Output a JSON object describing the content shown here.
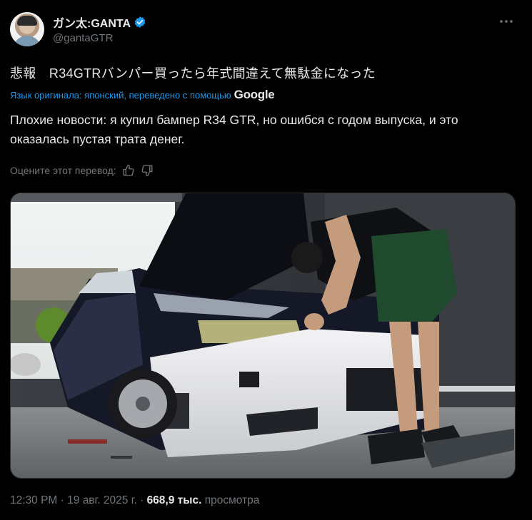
{
  "author": {
    "display_name": "ガン太:GANTA",
    "handle": "@gantaGTR",
    "verified_badge_icon": "verified-badge-icon",
    "avatar_icon": "avatar"
  },
  "post": {
    "original_text": "悲報　R34GTRバンパー買ったら年式間違えて無駄金になった",
    "translated_by_prefix": "Язык оригинала: японский, переведено с помощью",
    "translator_name": "Google",
    "translated_text": "Плохие новости: я купил бампер R34 GTR, но ошибся с годом выпуска, и это оказалась пустая трата денег.",
    "rate_label": "Оцените этот перевод:",
    "like_icon": "thumbs-up-icon",
    "dislike_icon": "thumbs-down-icon"
  },
  "footer": {
    "time": "12:30 PM",
    "date": "19 авг. 2025 г.",
    "views_count": "668,9 тыс.",
    "views_label": "просмотра"
  },
  "colors": {
    "background": "#000000",
    "text": "#e7e9ea",
    "secondary": "#71767b",
    "link": "#1d9bf0",
    "verified": "#1d9bf0"
  }
}
